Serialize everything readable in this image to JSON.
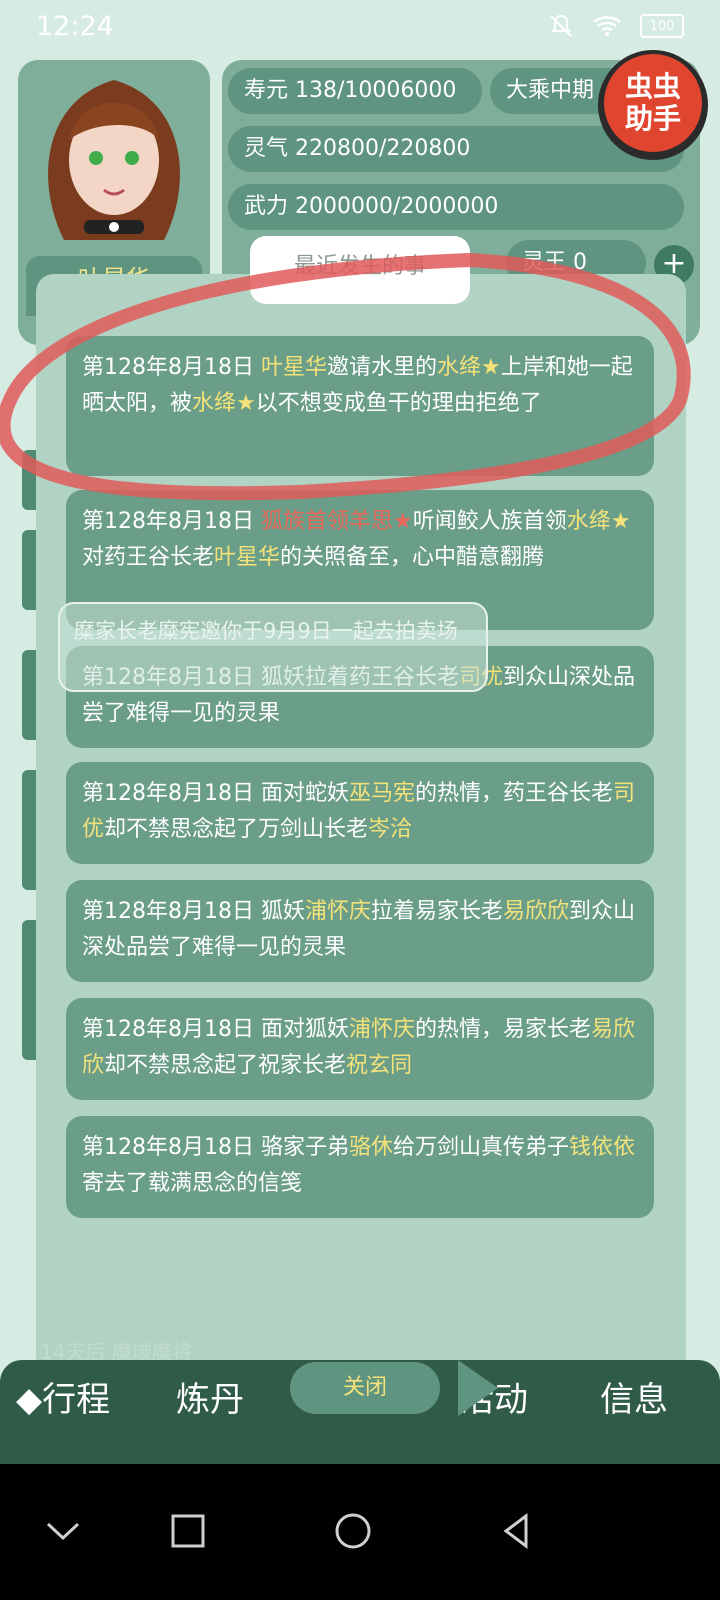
{
  "status_bar": {
    "time": "12:24",
    "battery": "100"
  },
  "character": {
    "name": "叶星华"
  },
  "stats": {
    "lifespan": "寿元 138/10006000",
    "realm": "大乘中期",
    "spirit": "灵气 220800/220800",
    "force": "武力 2000000/2000000",
    "spirit_king": "灵王 0"
  },
  "helper_badge": {
    "line1": "虫虫",
    "line2": "助手"
  },
  "modal": {
    "title": "最近发生的事",
    "events": [
      [
        {
          "t": "第128年8月18日 ",
          "c": "w"
        },
        {
          "t": "叶星华",
          "c": "y"
        },
        {
          "t": "邀请水里的",
          "c": "w"
        },
        {
          "t": "水绛★",
          "c": "y"
        },
        {
          "t": "上岸和她一起晒太阳，被",
          "c": "w"
        },
        {
          "t": "水绛★",
          "c": "y"
        },
        {
          "t": "以不想变成鱼干的理由拒绝了",
          "c": "w"
        }
      ],
      [
        {
          "t": "第128年8月18日 ",
          "c": "w"
        },
        {
          "t": "狐族首领羊思★",
          "c": "r"
        },
        {
          "t": "听闻鲛人族首领",
          "c": "w"
        },
        {
          "t": "水绛★",
          "c": "y"
        },
        {
          "t": "对药王谷长老",
          "c": "w"
        },
        {
          "t": "叶星华",
          "c": "y"
        },
        {
          "t": "的关照备至，心中醋意翻腾",
          "c": "w"
        }
      ],
      [
        {
          "t": "第128年8月18日 狐妖拉着药王谷长老",
          "c": "w"
        },
        {
          "t": "司优",
          "c": "y"
        },
        {
          "t": "到众山深处品尝了难得一见的灵果",
          "c": "w"
        }
      ],
      [
        {
          "t": "第128年8月18日 面对蛇妖",
          "c": "w"
        },
        {
          "t": "巫马宪",
          "c": "y"
        },
        {
          "t": "的热情，药王谷长老",
          "c": "w"
        },
        {
          "t": "司优",
          "c": "y"
        },
        {
          "t": "却不禁思念起了万剑山长老",
          "c": "w"
        },
        {
          "t": "岑洽",
          "c": "y"
        }
      ],
      [
        {
          "t": "第128年8月18日 狐妖",
          "c": "w"
        },
        {
          "t": "浦怀庆",
          "c": "y"
        },
        {
          "t": "拉着易家长老",
          "c": "w"
        },
        {
          "t": "易欣欣",
          "c": "y"
        },
        {
          "t": "到众山深处品尝了难得一见的灵果",
          "c": "w"
        }
      ],
      [
        {
          "t": "第128年8月18日 面对狐妖",
          "c": "w"
        },
        {
          "t": "浦怀庆",
          "c": "y"
        },
        {
          "t": "的热情，易家长老",
          "c": "w"
        },
        {
          "t": "易欣欣",
          "c": "y"
        },
        {
          "t": "却不禁思念起了祝家长老",
          "c": "w"
        },
        {
          "t": "祝玄同",
          "c": "y"
        }
      ],
      [
        {
          "t": "第128年8月18日 骆家子弟",
          "c": "w"
        },
        {
          "t": "骆休",
          "c": "y"
        },
        {
          "t": "给万剑山真传弟子",
          "c": "w"
        },
        {
          "t": "钱依依",
          "c": "y"
        },
        {
          "t": "寄去了载满思念的信笺",
          "c": "w"
        }
      ]
    ]
  },
  "toast": {
    "text": "糜家长老糜宪邀你于9月9日一起去拍卖场"
  },
  "background_text": "14天后 魔域魔将",
  "bottom_nav": {
    "items": [
      "◆行程",
      "炼丹",
      "活动",
      "信息"
    ],
    "close_label": "关闭"
  },
  "colors": {
    "highlight": "#f3e27a",
    "highlight_red": "#e86a5c",
    "annotation": "#e05a5a"
  }
}
